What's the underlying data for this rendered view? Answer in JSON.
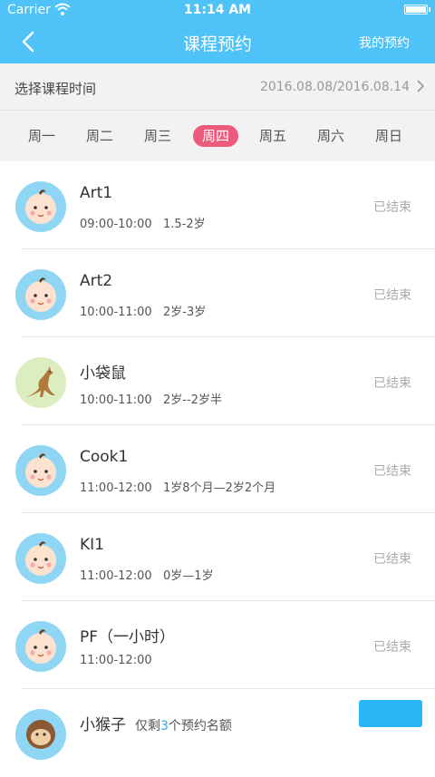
{
  "status_bar": {
    "carrier": "Carrier",
    "time": "11:14 AM"
  },
  "nav": {
    "title": "课程预约",
    "right_label": "我的预约"
  },
  "date_bar": {
    "label": "选择课程时间",
    "range": "2016.08.08/2016.08.14"
  },
  "weekdays": [
    {
      "label": "周一",
      "active": false
    },
    {
      "label": "周二",
      "active": false
    },
    {
      "label": "周三",
      "active": false
    },
    {
      "label": "周四",
      "active": true
    },
    {
      "label": "周五",
      "active": false
    },
    {
      "label": "周六",
      "active": false
    },
    {
      "label": "周日",
      "active": false
    }
  ],
  "courses": [
    {
      "name": "Art1",
      "time": "09:00-10:00",
      "age": "1.5-2岁",
      "status": "已结束",
      "avatar": "baby-face-icon"
    },
    {
      "name": "Art2",
      "time": "10:00-11:00",
      "age": "2岁-3岁",
      "status": "已结束",
      "avatar": "baby-face-icon"
    },
    {
      "name": "小袋鼠",
      "time": "10:00-11:00",
      "age": "2岁--2岁半",
      "status": "已结束",
      "avatar": "kangaroo-icon"
    },
    {
      "name": "Cook1",
      "time": "11:00-12:00",
      "age": "1岁8个月—2岁2个月",
      "status": "已结束",
      "avatar": "baby-face-icon"
    },
    {
      "name": "KI1",
      "time": "11:00-12:00",
      "age": "0岁—1岁",
      "status": "已结束",
      "avatar": "baby-face-icon"
    },
    {
      "name": "PF（一小时）",
      "time": "11:00-12:00",
      "age": "",
      "status": "已结束",
      "avatar": "baby-face-icon"
    },
    {
      "name": "小猴子",
      "quota_prefix": "仅剩",
      "quota_num": "3",
      "quota_suffix": "个预约名额",
      "avatar": "monkey-icon"
    }
  ],
  "colors": {
    "header": "#4fc3f7",
    "active_day": "#ec5b7b",
    "accent": "#29a9e0"
  }
}
